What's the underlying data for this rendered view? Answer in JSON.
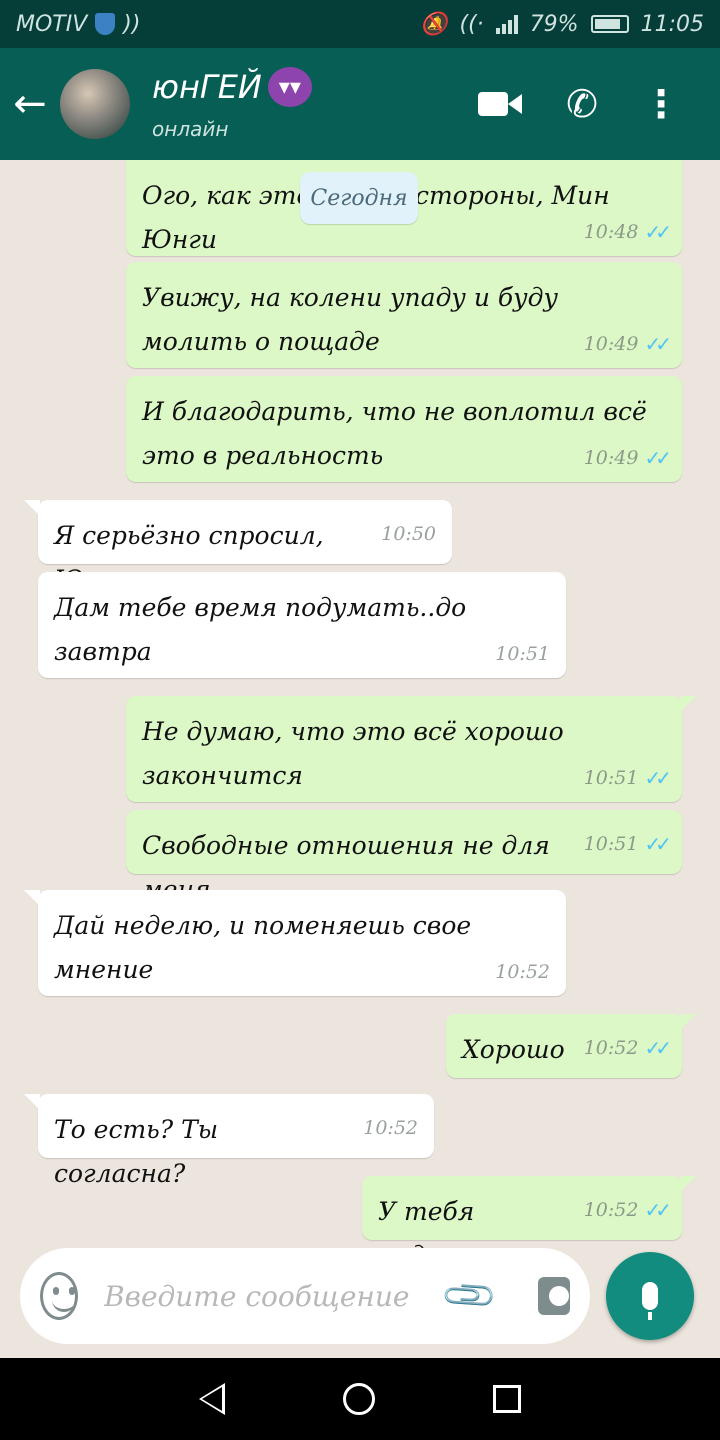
{
  "statusbar": {
    "carrier": "MOTIV",
    "battery": "79%",
    "time": "11:05"
  },
  "header": {
    "back_icon": "arrow-left-icon",
    "contact_name": "юнГЕЙ",
    "emoji": "😈",
    "status": "онлайн",
    "video_icon": "video-call-icon",
    "call_icon": "phone-icon",
    "menu_icon": "more-vertical-icon"
  },
  "date_pill": "Сегодня",
  "messages": [
    {
      "dir": "out",
      "text": "Ого, как это … шей стороны, Мин Юнги",
      "time": "10:48",
      "ticks": "✓✓"
    },
    {
      "dir": "out",
      "text": "Увижу, на колени упаду и буду молить о пощаде",
      "time": "10:49",
      "ticks": "✓✓"
    },
    {
      "dir": "out",
      "text": "И благодарить, что не воплотил всё это в реальность",
      "time": "10:49",
      "ticks": "✓✓"
    },
    {
      "dir": "in",
      "text": "Я серьёзно спросил, Юна",
      "time": "10:50"
    },
    {
      "dir": "in",
      "text": "Дам тебе время подумать..до завтра",
      "time": "10:51"
    },
    {
      "dir": "out",
      "text": " Не думаю, что это всё хорошо закончится",
      "time": "10:51",
      "ticks": "✓✓"
    },
    {
      "dir": "out",
      "text": "Свободные отношения не для меня",
      "time": "10:51",
      "ticks": "✓✓"
    },
    {
      "dir": "in",
      "text": "Дай неделю, и поменяешь свое мнение",
      "time": "10:52"
    },
    {
      "dir": "out",
      "text": "Хорошо",
      "time": "10:52",
      "ticks": "✓✓"
    },
    {
      "dir": "in",
      "text": "То есть? Ты согласна?",
      "time": "10:52"
    },
    {
      "dir": "out",
      "text": "У тебя неделя",
      "time": "10:52",
      "ticks": "✓✓"
    }
  ],
  "composer": {
    "placeholder": "Введите сообщение",
    "emoji_icon": "emoji-icon",
    "attach_icon": "paperclip-icon",
    "camera_icon": "camera-icon",
    "mic_icon": "microphone-icon"
  },
  "colors": {
    "statusbar": "#053d38",
    "appbar": "#075e54",
    "outgoing_bubble": "#dcf8c6",
    "incoming_bubble": "#ffffff",
    "chat_bg": "#ece5dd",
    "read_ticks": "#4fc3f7",
    "mic_button": "#128c7e"
  }
}
